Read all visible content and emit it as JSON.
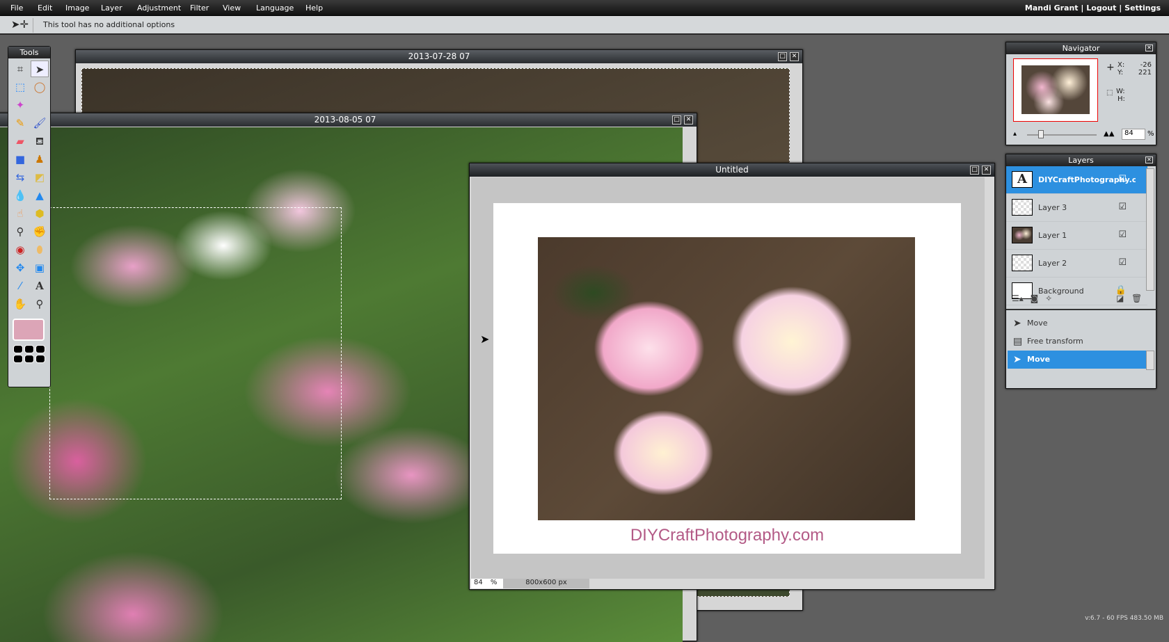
{
  "menu": {
    "items": [
      "File",
      "Edit",
      "Image",
      "Layer",
      "Adjustment",
      "Filter",
      "View",
      "Language",
      "Help"
    ],
    "user": "Mandi Grant",
    "logout": "Logout",
    "settings": "Settings",
    "sep": "|"
  },
  "options": {
    "text": "This tool has no additional options"
  },
  "tools": {
    "title": "Tools",
    "items": [
      "crop",
      "move",
      "marquee",
      "lasso",
      "magic-wand",
      "pencil",
      "brush",
      "eraser",
      "bucket",
      "gradient",
      "clone-stamp",
      "color-replace",
      "shapes",
      "blur",
      "sharpen",
      "smudge",
      "sponge",
      "burn",
      "dodge",
      "red-eye",
      "spot-heal",
      "bloat",
      "pinch",
      "color-picker",
      "type",
      "hand",
      "zoom"
    ],
    "foreground_color": "#dca5b7"
  },
  "windows": {
    "w1": {
      "title": "2013-07-28 07"
    },
    "w2": {
      "title": "2013-08-05 07"
    },
    "untitled": {
      "title": "Untitled",
      "watermark": "DIYCraftPhotography.com",
      "zoom": "84",
      "zoom_unit": "%",
      "size": "800x600 px"
    }
  },
  "navigator": {
    "title": "Navigator",
    "x_label": "X:",
    "x": "-26",
    "y_label": "Y:",
    "y": "221",
    "w_label": "W:",
    "h_label": "H:",
    "zoom": "84",
    "zoom_unit": "%"
  },
  "layers": {
    "title": "Layers",
    "items": [
      {
        "name": "DIYCraftPhotography.com",
        "visible": true,
        "selected": true
      },
      {
        "name": "Layer 3",
        "visible": true
      },
      {
        "name": "Layer 1",
        "visible": true
      },
      {
        "name": "Layer 2",
        "visible": true
      },
      {
        "name": "Background",
        "locked": true
      }
    ]
  },
  "history": {
    "items": [
      {
        "label": "Move"
      },
      {
        "label": "Free transform"
      },
      {
        "label": "Move",
        "selected": true
      }
    ]
  },
  "status": {
    "version": "v:6.7 - 60 FPS 483.50 MB"
  },
  "colors": {
    "accent": "#2d90e0",
    "watermark": "#b35a86"
  }
}
